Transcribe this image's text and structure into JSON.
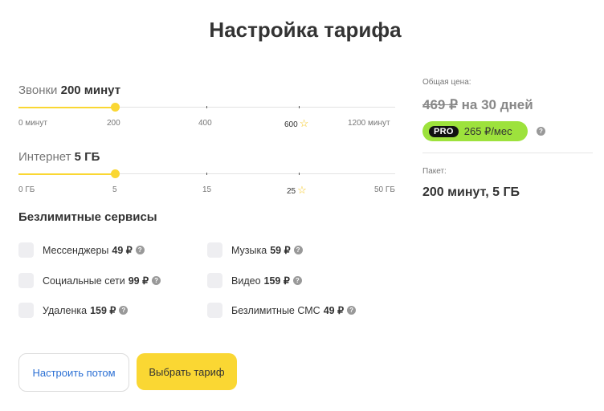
{
  "title": "Настройка тарифа",
  "calls": {
    "label": "Звонки",
    "value": "200 минут",
    "progress_fraction": 0.256,
    "ticks": [
      "0 минут",
      "200",
      "400",
      "600",
      "1200 минут"
    ]
  },
  "internet": {
    "label": "Интернет",
    "value": "5 ГБ",
    "progress_fraction": 0.256,
    "ticks": [
      "0 ГБ",
      "5",
      "15",
      "25",
      "50 ГБ"
    ]
  },
  "services": {
    "title": "Безлимитные сервисы",
    "items": [
      {
        "label": "Мессенджеры",
        "price": "49 ₽",
        "checked": false
      },
      {
        "label": "Музыка",
        "price": "59 ₽",
        "checked": false
      },
      {
        "label": "Социальные сети",
        "price": "99 ₽",
        "checked": false
      },
      {
        "label": "Видео",
        "price": "159 ₽",
        "checked": false
      },
      {
        "label": "Удаленка",
        "price": "159 ₽",
        "checked": false
      },
      {
        "label": "Безлимитные СМС",
        "price": "49 ₽",
        "checked": false
      }
    ]
  },
  "buttons": {
    "later": "Настроить потом",
    "choose": "Выбрать тариф"
  },
  "summary": {
    "total_label": "Общая цена:",
    "old_price": "469 ₽",
    "period": "на 30 дней",
    "pro_tag": "PRO",
    "pro_price": "265 ₽/мес",
    "package_label": "Пакет:",
    "package_value": "200 минут, 5 ГБ"
  },
  "icons": {
    "question": "question-circle-icon",
    "star": "star-icon"
  },
  "colors": {
    "accent": "#fad733",
    "pro_badge": "#9de23c",
    "link": "#2a6fd4"
  }
}
